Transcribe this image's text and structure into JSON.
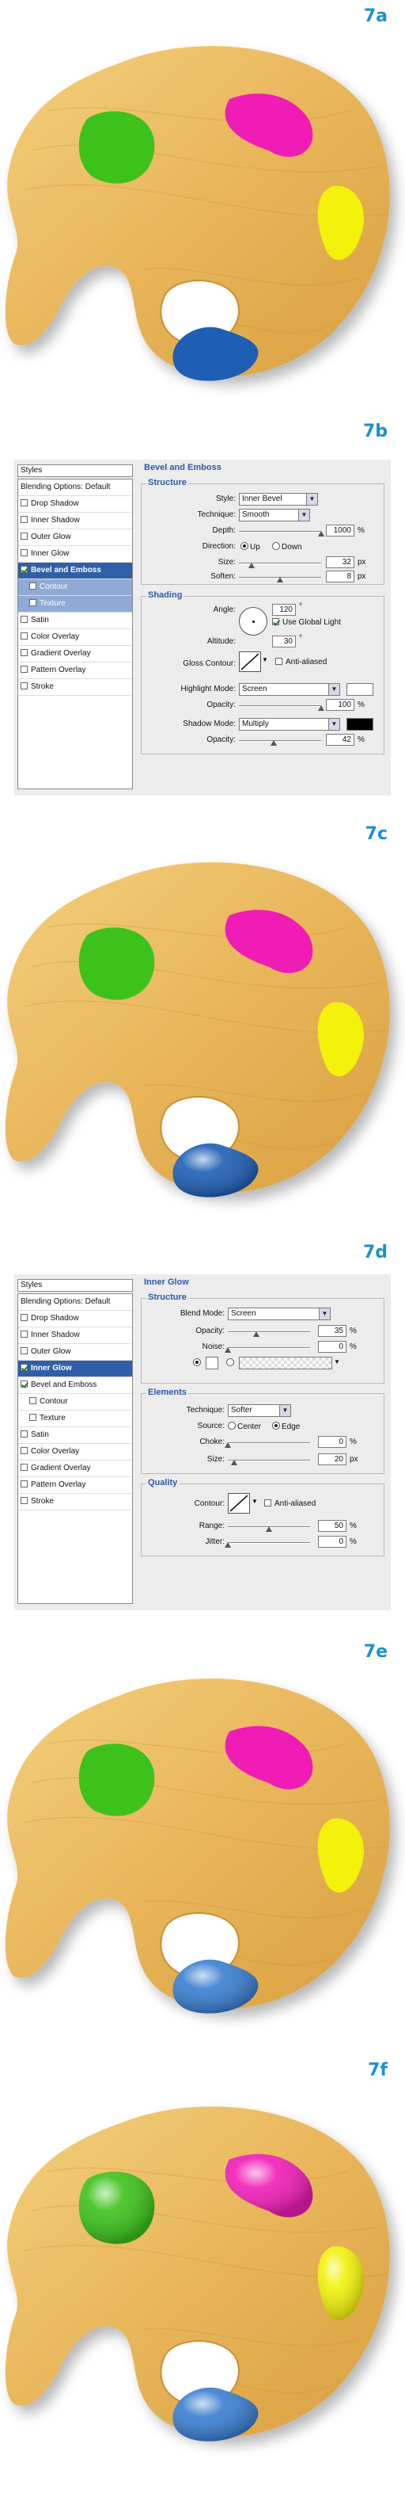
{
  "steps": {
    "a": "7a",
    "b": "7b",
    "c": "7c",
    "d": "7d",
    "e": "7e",
    "f": "7f"
  },
  "colors": {
    "accent": "#1e90d0",
    "paint_green": "#3cc21a",
    "paint_magenta": "#f01cb6",
    "paint_yellow": "#f2f20a",
    "paint_blue": "#1e5eb4",
    "wood": "#e9b858"
  },
  "bevel_dialog": {
    "styles_title": "Styles",
    "list": [
      {
        "label": "Blending Options: Default",
        "check": false,
        "state": "header"
      },
      {
        "label": "Drop Shadow",
        "check": true,
        "checked": false,
        "state": "normal"
      },
      {
        "label": "Inner Shadow",
        "check": true,
        "checked": false,
        "state": "normal"
      },
      {
        "label": "Outer Glow",
        "check": true,
        "checked": false,
        "state": "normal"
      },
      {
        "label": "Inner Glow",
        "check": true,
        "checked": false,
        "state": "normal"
      },
      {
        "label": "Bevel and Emboss",
        "check": true,
        "checked": true,
        "state": "selected"
      },
      {
        "label": "Contour",
        "check": true,
        "checked": false,
        "state": "subselected"
      },
      {
        "label": "Texture",
        "check": true,
        "checked": false,
        "state": "subselected"
      },
      {
        "label": "Satin",
        "check": true,
        "checked": false,
        "state": "normal"
      },
      {
        "label": "Color Overlay",
        "check": true,
        "checked": false,
        "state": "normal"
      },
      {
        "label": "Gradient Overlay",
        "check": true,
        "checked": false,
        "state": "normal"
      },
      {
        "label": "Pattern Overlay",
        "check": true,
        "checked": false,
        "state": "normal"
      },
      {
        "label": "Stroke",
        "check": true,
        "checked": false,
        "state": "normal"
      }
    ],
    "panel_title": "Bevel and Emboss",
    "structure_title": "Structure",
    "style_label": "Style:",
    "style_value": "Inner Bevel",
    "technique_label": "Technique:",
    "technique_value": "Smooth",
    "depth_label": "Depth:",
    "depth_value": "1000",
    "depth_pos": 1.0,
    "percent": "%",
    "px": "px",
    "direction_label": "Direction:",
    "up_label": "Up",
    "down_label": "Down",
    "size_label": "Size:",
    "size_value": "32",
    "size_pos": 0.15,
    "soften_label": "Soften:",
    "soften_value": "8",
    "soften_pos": 0.5,
    "shading_title": "Shading",
    "angle_label": "Angle:",
    "angle_value": "120",
    "degree": "°",
    "use_global_light": "Use Global Light",
    "altitude_label": "Altitude:",
    "altitude_value": "30",
    "gloss_contour_label": "Gloss Contour:",
    "anti_aliased": "Anti-aliased",
    "highlight_mode_label": "Highlight Mode:",
    "highlight_mode_value": "Screen",
    "highlight_color": "#ffffff",
    "highlight_opacity_label": "Opacity:",
    "highlight_opacity_value": "100",
    "highlight_opacity_pos": 1.0,
    "shadow_mode_label": "Shadow Mode:",
    "shadow_mode_value": "Multiply",
    "shadow_color": "#000000",
    "shadow_opacity_label": "Opacity:",
    "shadow_opacity_value": "42",
    "shadow_opacity_pos": 0.42
  },
  "glow_dialog": {
    "styles_title": "Styles",
    "list": [
      {
        "label": "Blending Options: Default",
        "check": false,
        "state": "header"
      },
      {
        "label": "Drop Shadow",
        "check": true,
        "checked": false,
        "state": "normal"
      },
      {
        "label": "Inner Shadow",
        "check": true,
        "checked": false,
        "state": "normal"
      },
      {
        "label": "Outer Glow",
        "check": true,
        "checked": false,
        "state": "normal"
      },
      {
        "label": "Inner Glow",
        "check": true,
        "checked": true,
        "state": "selected"
      },
      {
        "label": "Bevel and Emboss",
        "check": true,
        "checked": true,
        "state": "normal"
      },
      {
        "label": "Contour",
        "check": true,
        "checked": false,
        "state": "sub"
      },
      {
        "label": "Texture",
        "check": true,
        "checked": false,
        "state": "sub"
      },
      {
        "label": "Satin",
        "check": true,
        "checked": false,
        "state": "normal"
      },
      {
        "label": "Color Overlay",
        "check": true,
        "checked": false,
        "state": "normal"
      },
      {
        "label": "Gradient Overlay",
        "check": true,
        "checked": false,
        "state": "normal"
      },
      {
        "label": "Pattern Overlay",
        "check": true,
        "checked": false,
        "state": "normal"
      },
      {
        "label": "Stroke",
        "check": true,
        "checked": false,
        "state": "normal"
      }
    ],
    "panel_title": "Inner Glow",
    "structure_title": "Structure",
    "blend_mode_label": "Blend Mode:",
    "blend_mode_value": "Screen",
    "opacity_label": "Opacity:",
    "opacity_value": "35",
    "opacity_pos": 0.35,
    "noise_label": "Noise:",
    "noise_value": "0",
    "noise_pos": 0.0,
    "percent": "%",
    "px": "px",
    "elements_title": "Elements",
    "technique_label": "Technique:",
    "technique_value": "Softer",
    "source_label": "Source:",
    "center_label": "Center",
    "edge_label": "Edge",
    "choke_label": "Choke:",
    "choke_value": "0",
    "choke_pos": 0.0,
    "size_label": "Size:",
    "size_value": "20",
    "size_pos": 0.08,
    "quality_title": "Quality",
    "contour_label": "Contour:",
    "anti_aliased": "Anti-aliased",
    "range_label": "Range:",
    "range_value": "50",
    "range_pos": 0.5,
    "jitter_label": "Jitter:",
    "jitter_value": "0",
    "jitter_pos": 0.0
  }
}
